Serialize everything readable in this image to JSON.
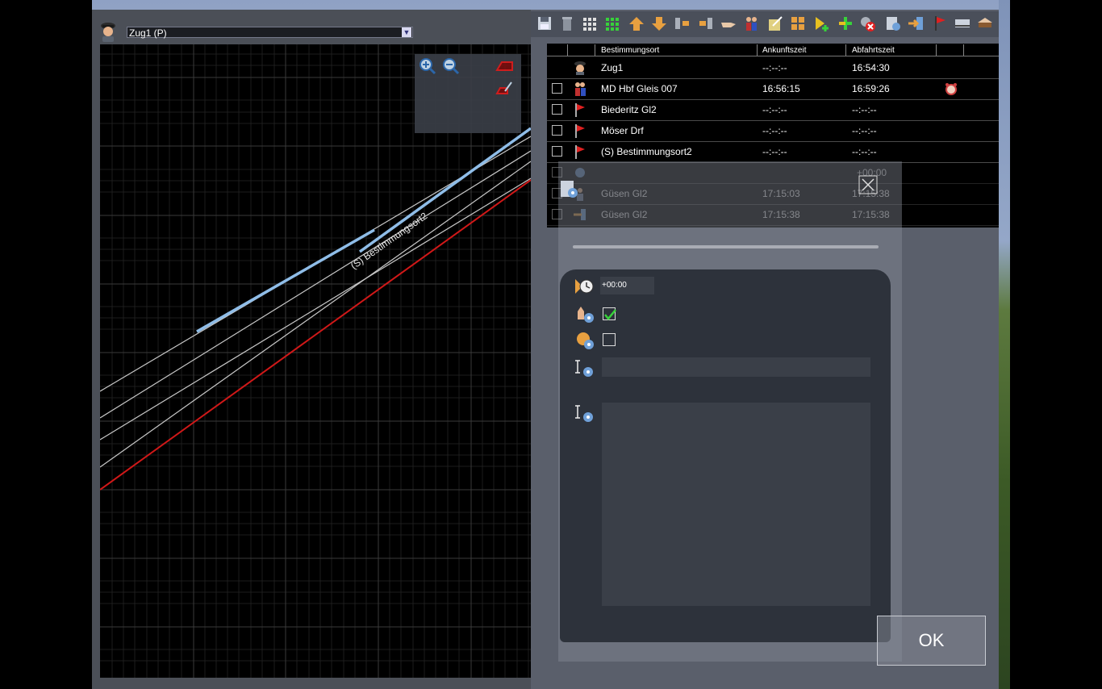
{
  "graph": {
    "train_select": "Zug1 (P)",
    "label_destination": "(S) Bestimmungsort2"
  },
  "table": {
    "headers": [
      "Bestimmungsort",
      "Ankunftszeit",
      "Abfahrtszeit"
    ],
    "rows": [
      {
        "name": "Zug1",
        "arrival": "--:--:--",
        "departure": "16:54:30"
      },
      {
        "name": "MD Hbf Gleis 007",
        "arrival": "16:56:15",
        "departure": "16:59:26"
      },
      {
        "name": "Biederitz Gl2",
        "arrival": "--:--:--",
        "departure": "--:--:--"
      },
      {
        "name": "Möser Drf",
        "arrival": "--:--:--",
        "departure": "--:--:--"
      },
      {
        "name": "(S) Bestimmungsort2",
        "arrival": "--:--:--",
        "departure": "--:--:--"
      },
      {
        "name": "",
        "arrival": "",
        "departure": "+00:00"
      },
      {
        "name": "Güsen Gl2",
        "arrival": "17:15:03",
        "departure": "17:15:38"
      },
      {
        "name": "Güsen Gl2",
        "arrival": "17:15:38",
        "departure": "17:15:38"
      }
    ]
  },
  "dialog": {
    "offset": "+00:00",
    "check1": true,
    "check2": false,
    "ok": "OK"
  },
  "colors": {
    "route_line": "#d01818",
    "highlight": "#8fbde8",
    "grid": "#3a3a3a"
  }
}
